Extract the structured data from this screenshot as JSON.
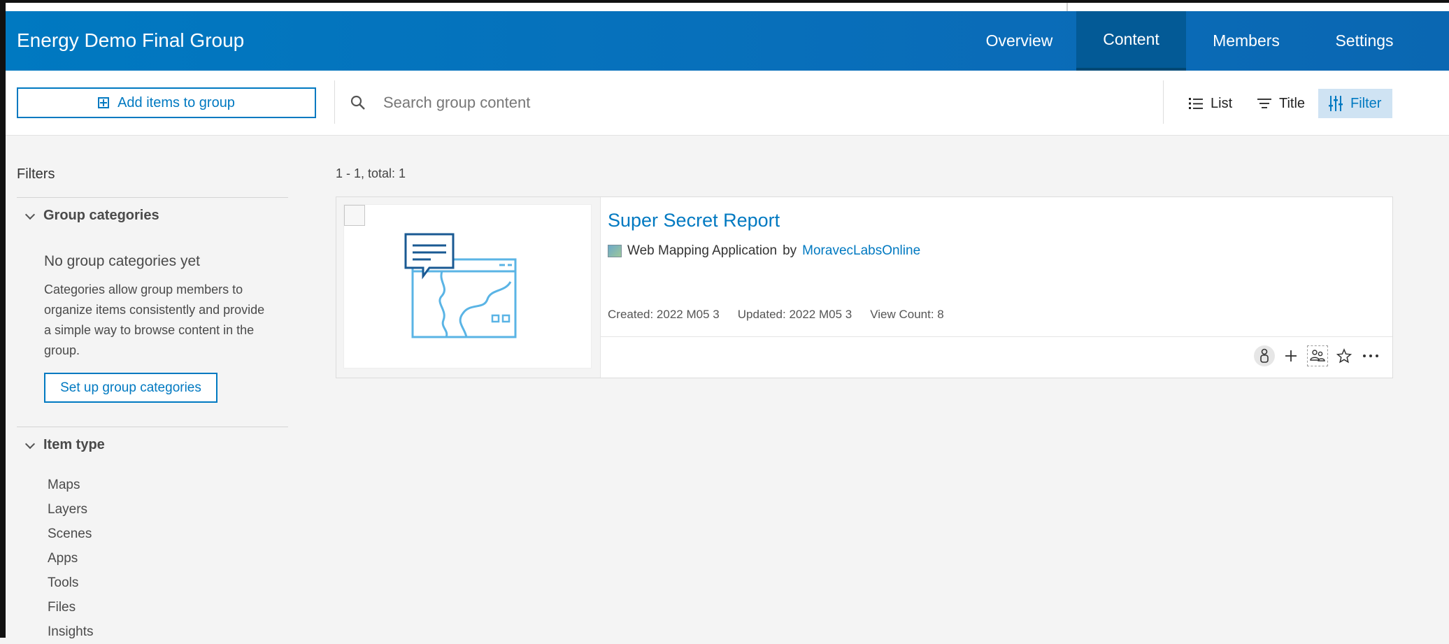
{
  "header": {
    "title": "Energy Demo Final Group",
    "tabs": [
      "Overview",
      "Content",
      "Members",
      "Settings"
    ],
    "active_tab": "Content"
  },
  "toolbar": {
    "add_label": "Add items to group",
    "search_placeholder": "Search group content",
    "list_label": "List",
    "sort_label": "Title",
    "filter_label": "Filter"
  },
  "filters": {
    "title": "Filters",
    "categories": {
      "heading": "Group categories",
      "empty_title": "No group categories yet",
      "empty_desc": "Categories allow group members to organize items consistently and provide a simple way to browse content in the group.",
      "setup_label": "Set up group categories"
    },
    "item_type": {
      "heading": "Item type",
      "items": [
        "Maps",
        "Layers",
        "Scenes",
        "Apps",
        "Tools",
        "Files",
        "Insights"
      ]
    }
  },
  "results": {
    "count": "1 - 1, total: 1",
    "items": [
      {
        "title": "Super Secret Report",
        "type": "Web Mapping Application",
        "by": "by",
        "owner": "MoravecLabsOnline",
        "created": "Created: 2022 M05 3",
        "updated": "Updated: 2022 M05 3",
        "views": "View Count: 8"
      }
    ]
  },
  "colors": {
    "brand": "#0079c1",
    "header_active": "#035a96",
    "filter_active_bg": "#cfe3f3"
  },
  "icons": [
    "search-icon",
    "list-icon",
    "sort-icon",
    "filter-icon",
    "plus-icon",
    "chevron-down-icon",
    "owner-icon",
    "add-icon",
    "share-group-icon",
    "favorite-star-icon",
    "more-icon"
  ]
}
